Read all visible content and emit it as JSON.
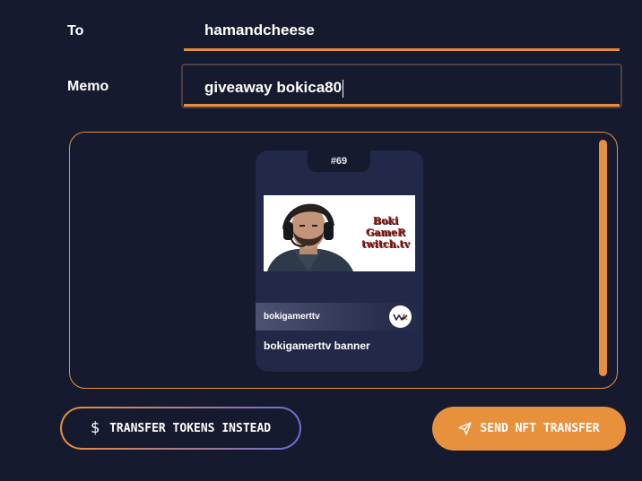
{
  "form": {
    "to_label": "To",
    "to_value": "hamandcheese",
    "memo_label": "Memo",
    "memo_value": "giveaway bokica80"
  },
  "nft": {
    "id": "#69",
    "collection": "bokigamerttv",
    "name": "bokigamerttv banner",
    "image_text_lines": [
      "Boki",
      "GameR",
      "twitch.tv"
    ],
    "chain_logo": "wax-logo"
  },
  "buttons": {
    "transfer_tokens_label": "TRANSFER TOKENS INSTEAD",
    "send_nft_label": "SEND NFT TRANSFER"
  },
  "icons": {
    "dollar": "dollar-icon",
    "send": "paper-plane-icon"
  },
  "colors": {
    "background": "#161a2e",
    "accent": "#ea8f39",
    "card": "#222847",
    "gradient_end": "#6b6dd8"
  }
}
